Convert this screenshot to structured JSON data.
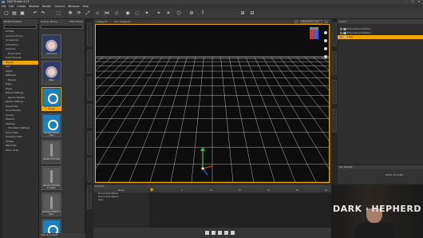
{
  "window": {
    "title": "DAZ Studio 4.21",
    "controls": [
      "–",
      "□",
      "✕"
    ]
  },
  "menu": {
    "items": [
      "File",
      "Edit",
      "Create",
      "Window",
      "Render",
      "Connect",
      "Windows",
      "Help"
    ]
  },
  "toolbar": {
    "tools": [
      "new-icon",
      "open-icon",
      "save-icon",
      "undo-icon",
      "redo-icon",
      "select-icon",
      "move-icon",
      "rotate-icon",
      "scale-icon",
      "transform-icon",
      "joint-icon",
      "geometry-icon",
      "render-icon",
      "spot-render-icon",
      "node-icon",
      "camera-icon",
      "light-icon",
      "primitive-icon",
      "settings-icon",
      "help-icon"
    ]
  },
  "content_library": {
    "header": "Smart Content",
    "categories": [
      {
        "label": "All Files",
        "selected": false
      },
      {
        "label": "Lost and Found",
        "selected": false
      },
      {
        "label": "Accessories",
        "selected": false
      },
      {
        "label": "Animations",
        "selected": false
      },
      {
        "label": "Cameras",
        "selected": false
      },
      {
        "label": "Documents",
        "selected": false,
        "sub": true
      },
      {
        "label": "Environments",
        "selected": false
      },
      {
        "label": "Figures",
        "selected": true
      },
      {
        "label": "Hair",
        "selected": false
      },
      {
        "label": "Lights",
        "selected": false
      },
      {
        "label": "Materials",
        "selected": false
      },
      {
        "label": "Morphs",
        "selected": false,
        "sub": true
      },
      {
        "label": "Props",
        "selected": false
      },
      {
        "label": "Poses",
        "selected": false
      },
      {
        "label": "Render Settings",
        "selected": false
      },
      {
        "label": "Render Presets",
        "selected": false,
        "sub": true
      },
      {
        "label": "Render Settings",
        "selected": false
      },
      {
        "label": "Saved Files",
        "selected": false
      },
      {
        "label": "Scene Builder",
        "selected": false
      },
      {
        "label": "Scenes",
        "selected": false
      },
      {
        "label": "Shaders",
        "selected": false
      },
      {
        "label": "Shading",
        "selected": false
      },
      {
        "label": "Simulation Settings",
        "selected": false,
        "sub": true
      },
      {
        "label": "Sound Files",
        "selected": false
      },
      {
        "label": "Transition Files",
        "selected": false
      },
      {
        "label": "Utilities",
        "selected": false
      },
      {
        "label": "Wardrobe",
        "selected": false
      },
      {
        "label": "Other Links",
        "selected": false
      }
    ]
  },
  "content_items": {
    "tab_left": "Sort by Name",
    "tab_right": "Hide Filters",
    "footer": "Filter By Context",
    "items": [
      {
        "label": "Victoria 8.1",
        "thumb": "face",
        "selected": false
      },
      {
        "label": "Babe",
        "thumb": "face",
        "selected": false
      },
      {
        "label": "Genesis 8 Basic Female",
        "thumb": "box",
        "selected": true
      },
      {
        "label": "Genesis 8 Basic Male",
        "thumb": "box",
        "selected": false
      },
      {
        "label": "Genesis 8 Female",
        "thumb": "figure",
        "selected": false
      },
      {
        "label": "Genesis 8 Female 8.1 Basic",
        "thumb": "figure",
        "selected": false
      },
      {
        "label": "Genesis 8 Male 8.1 Basic",
        "thumb": "figure",
        "selected": false
      },
      {
        "label": "Genesis 8 Basic Child",
        "thumb": "box",
        "selected": false
      }
    ]
  },
  "viewport": {
    "tab_active": "Viewport",
    "tab_other": "Aux Viewport",
    "camera": "Perspective View",
    "colors": {
      "background": "#0d0d0d",
      "grid": "#b8b8b8",
      "frame": "#f0a800",
      "axis_x": "#d23b3b",
      "axis_y": "#37c85a",
      "axis_z": "#3b63d9"
    }
  },
  "scene": {
    "header": "Scene",
    "rows": [
      {
        "label": "Environment Options",
        "selected": false
      },
      {
        "label": "Environment Options",
        "selected": false
      },
      {
        "label": "Chair",
        "selected": true
      }
    ]
  },
  "tool_settings": {
    "header": "Tool Settings",
    "value": "Off 4K, 0% 0.987"
  },
  "timeline": {
    "header": "Timeline",
    "column": "Name",
    "rows": [
      "Environment Options",
      "Environment Options",
      "Chair"
    ],
    "ruler": [
      "0",
      "5",
      "10",
      "15",
      "20",
      "25",
      "30"
    ]
  },
  "webcam": {
    "logo_left": "DARK",
    "logo_right": "HEPHERD"
  }
}
